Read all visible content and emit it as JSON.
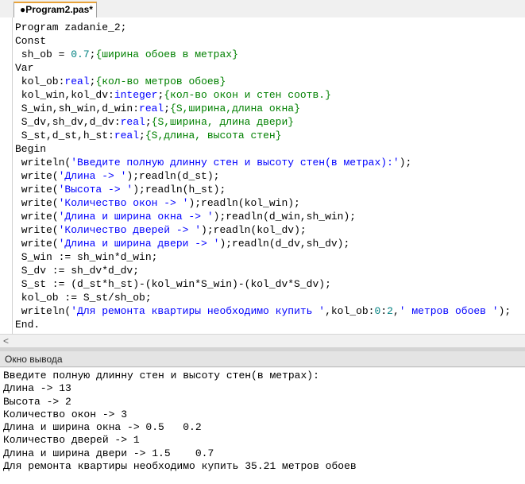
{
  "tab": {
    "label": "●Program2.pas*"
  },
  "editor": {
    "lines": [
      [
        {
          "t": "Program zadanie_2;",
          "c": "kw"
        }
      ],
      [
        {
          "t": "Const",
          "c": "kw"
        }
      ],
      [
        {
          "t": " sh_ob = ",
          "c": "kw"
        },
        {
          "t": "0.7",
          "c": "num"
        },
        {
          "t": ";",
          "c": "kw"
        },
        {
          "t": "{ширина обоев в метрах}",
          "c": "cmt"
        }
      ],
      [
        {
          "t": "Var",
          "c": "kw"
        }
      ],
      [
        {
          "t": " kol_ob:",
          "c": "kw"
        },
        {
          "t": "real",
          "c": "type"
        },
        {
          "t": ";",
          "c": "kw"
        },
        {
          "t": "{кол-во метров обоев}",
          "c": "cmt"
        }
      ],
      [
        {
          "t": " kol_win,kol_dv:",
          "c": "kw"
        },
        {
          "t": "integer",
          "c": "type"
        },
        {
          "t": ";",
          "c": "kw"
        },
        {
          "t": "{кол-во окон и стен соотв.}",
          "c": "cmt"
        }
      ],
      [
        {
          "t": " S_win,sh_win,d_win:",
          "c": "kw"
        },
        {
          "t": "real",
          "c": "type"
        },
        {
          "t": ";",
          "c": "kw"
        },
        {
          "t": "{S,ширина,длина окна}",
          "c": "cmt"
        }
      ],
      [
        {
          "t": " S_dv,sh_dv,d_dv:",
          "c": "kw"
        },
        {
          "t": "real",
          "c": "type"
        },
        {
          "t": ";",
          "c": "kw"
        },
        {
          "t": "{S,ширина, длина двери}",
          "c": "cmt"
        }
      ],
      [
        {
          "t": " S_st,d_st,h_st:",
          "c": "kw"
        },
        {
          "t": "real",
          "c": "type"
        },
        {
          "t": ";",
          "c": "kw"
        },
        {
          "t": "{S,длина, высота стен}",
          "c": "cmt"
        }
      ],
      [
        {
          "t": "Begin",
          "c": "kw"
        }
      ],
      [
        {
          "t": " writeln(",
          "c": "kw"
        },
        {
          "t": "'Введите полную длинну стен и высоту стен(в метрах):'",
          "c": "str"
        },
        {
          "t": ");",
          "c": "kw"
        }
      ],
      [
        {
          "t": " write(",
          "c": "kw"
        },
        {
          "t": "'Длина -> '",
          "c": "str"
        },
        {
          "t": ");readln(d_st);",
          "c": "kw"
        }
      ],
      [
        {
          "t": " write(",
          "c": "kw"
        },
        {
          "t": "'Высота -> '",
          "c": "str"
        },
        {
          "t": ");readln(h_st);",
          "c": "kw"
        }
      ],
      [
        {
          "t": " write(",
          "c": "kw"
        },
        {
          "t": "'Количество окон -> '",
          "c": "str"
        },
        {
          "t": ");readln(kol_win);",
          "c": "kw"
        }
      ],
      [
        {
          "t": " write(",
          "c": "kw"
        },
        {
          "t": "'Длина и ширина окна -> '",
          "c": "str"
        },
        {
          "t": ");readln(d_win,sh_win);",
          "c": "kw"
        }
      ],
      [
        {
          "t": " write(",
          "c": "kw"
        },
        {
          "t": "'Количество дверей -> '",
          "c": "str"
        },
        {
          "t": ");readln(kol_dv);",
          "c": "kw"
        }
      ],
      [
        {
          "t": " write(",
          "c": "kw"
        },
        {
          "t": "'Длина и ширина двери -> '",
          "c": "str"
        },
        {
          "t": ");readln(d_dv,sh_dv);",
          "c": "kw"
        }
      ],
      [
        {
          "t": " S_win := sh_win*d_win;",
          "c": "kw"
        }
      ],
      [
        {
          "t": " S_dv := sh_dv*d_dv;",
          "c": "kw"
        }
      ],
      [
        {
          "t": " S_st := (d_st*h_st)-(kol_win*S_win)-(kol_dv*S_dv);",
          "c": "kw"
        }
      ],
      [
        {
          "t": " kol_ob := S_st/sh_ob;",
          "c": "kw"
        }
      ],
      [
        {
          "t": " writeln(",
          "c": "kw"
        },
        {
          "t": "'Для ремонта квартиры необходимо купить '",
          "c": "str"
        },
        {
          "t": ",kol_ob:",
          "c": "kw"
        },
        {
          "t": "0",
          "c": "num"
        },
        {
          "t": ":",
          "c": "kw"
        },
        {
          "t": "2",
          "c": "num"
        },
        {
          "t": ",",
          "c": "kw"
        },
        {
          "t": "' метров обоев '",
          "c": "str"
        },
        {
          "t": ");",
          "c": "kw"
        }
      ],
      [
        {
          "t": "End.",
          "c": "kw"
        }
      ]
    ]
  },
  "scroll": {
    "left_arrow": "<"
  },
  "output_panel": {
    "title": "Окно вывода",
    "lines": [
      "Введите полную длинну стен и высоту стен(в метрах):",
      "Длина -> 13",
      "Высота -> 2",
      "Количество окон -> 3",
      "Длина и ширина окна -> 0.5   0.2",
      "Количество дверей -> 1",
      "Длина и ширина двери -> 1.5    0.7",
      "Для ремонта квартиры необходимо купить 35.21 метров обоев"
    ]
  },
  "colors": {
    "tab_accent": "#e8a33a",
    "keyword": "#000000",
    "type": "#0000ff",
    "string": "#0000ff",
    "comment": "#008000",
    "number": "#008080"
  }
}
